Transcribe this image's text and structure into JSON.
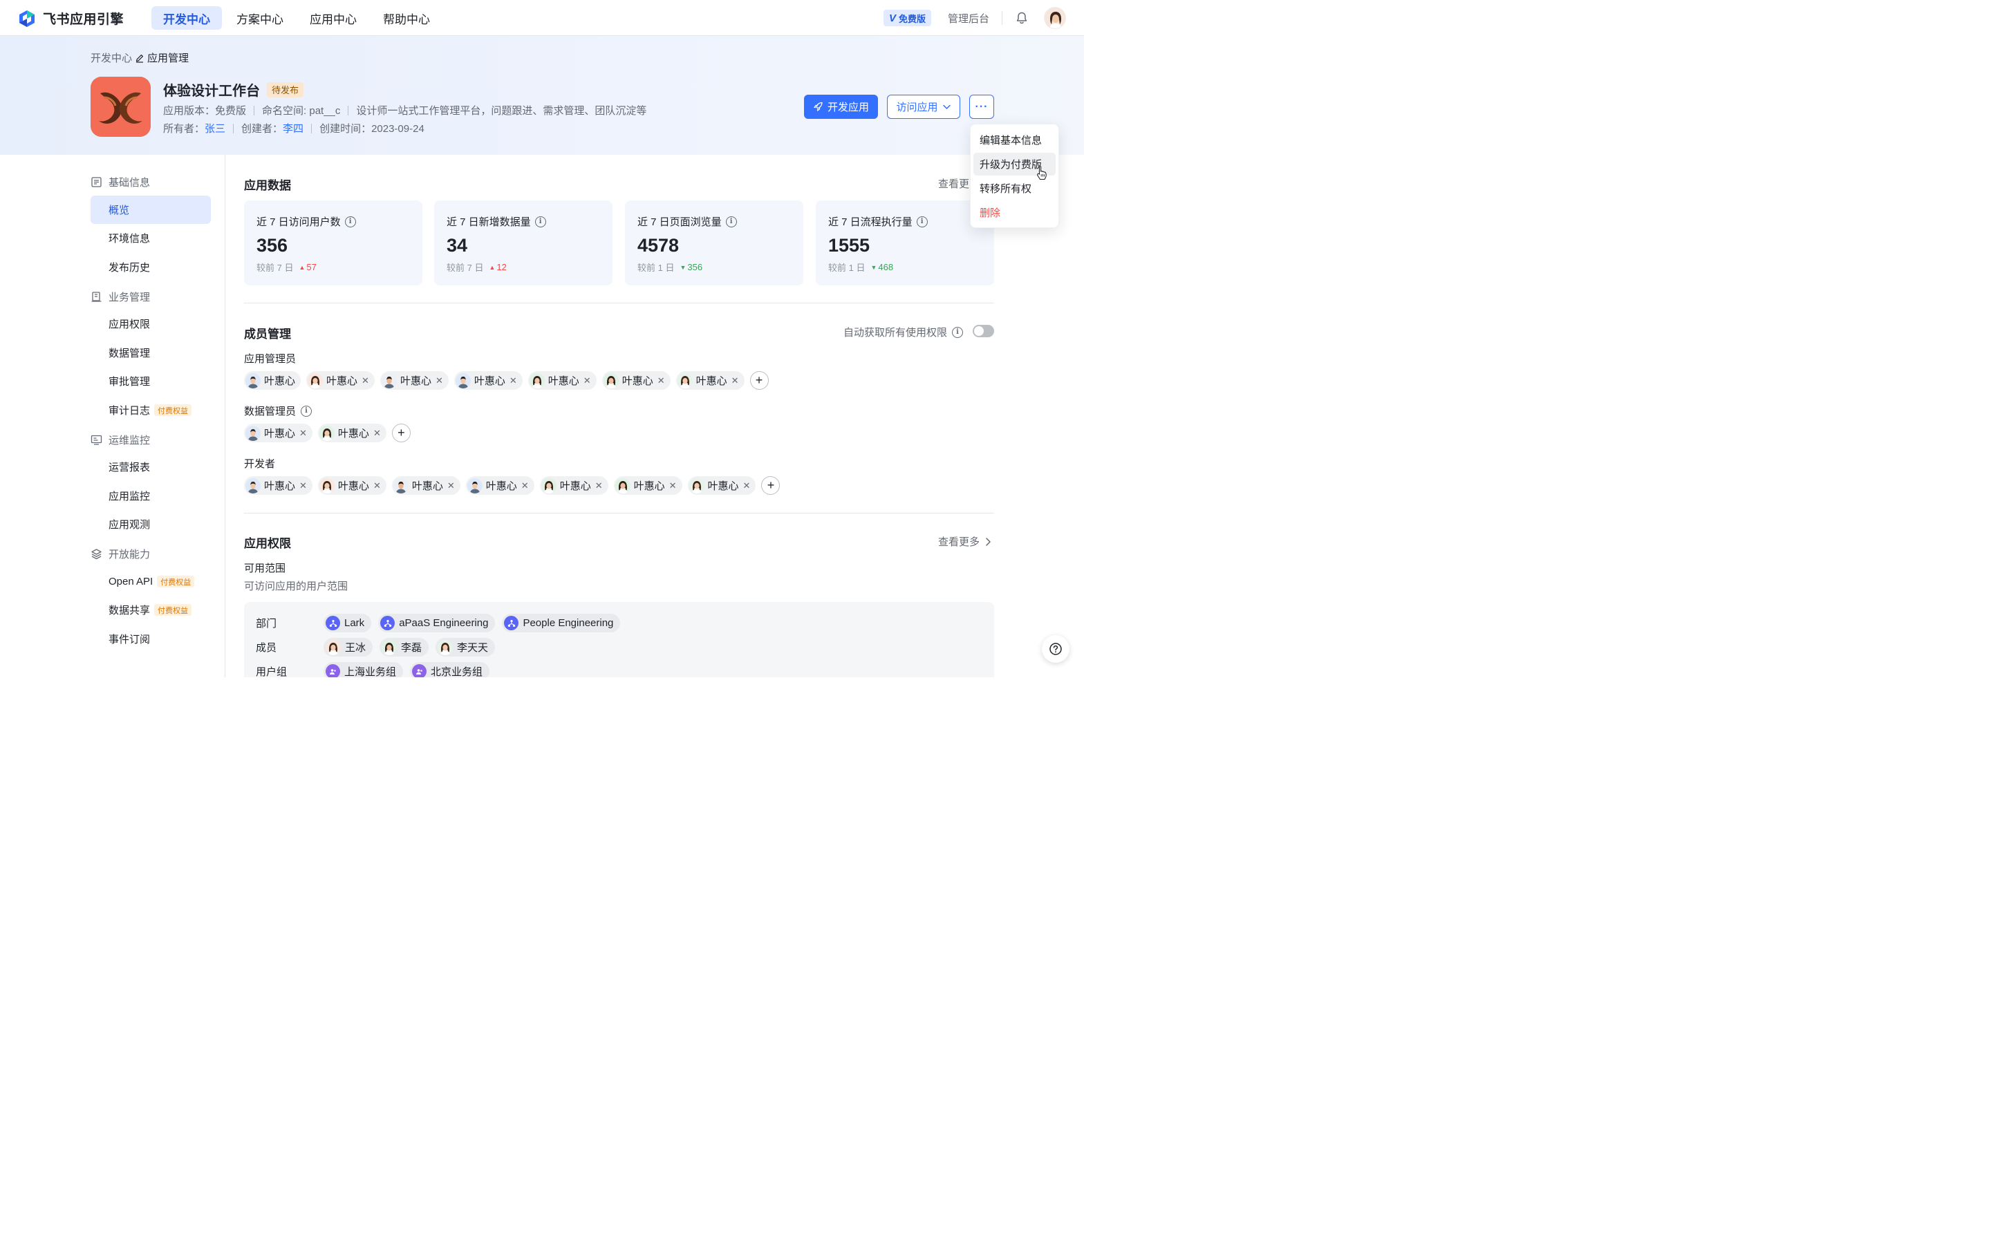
{
  "brand": {
    "name": "飞书应用引擎"
  },
  "nav": {
    "tabs": [
      "开发中心",
      "方案中心",
      "应用中心",
      "帮助中心"
    ],
    "plan_badge": "免费版",
    "plan_v": "V",
    "admin": "管理后台"
  },
  "breadcrumb": {
    "root": "开发中心",
    "current": "应用管理"
  },
  "app": {
    "name": "体验设计工作台",
    "status": "待发布",
    "version": "应用版本：免费版",
    "namespace": "命名空间: pat__c",
    "description": "设计师一站式工作管理平台，问题跟进、需求管理、团队沉淀等",
    "owner_label": "所有者：",
    "owner": "张三",
    "creator_label": "创建者：",
    "creator": "李四",
    "created": "创建时间：2023-09-24"
  },
  "actions": {
    "develop": "开发应用",
    "visit": "访问应用",
    "more": "···"
  },
  "dropdown": {
    "items": [
      "编辑基本信息",
      "升级为付费版",
      "转移所有权",
      "删除"
    ]
  },
  "sidebar": {
    "groups": [
      "基础信息",
      "业务管理",
      "运维监控",
      "开放能力"
    ],
    "items": [
      "概览",
      "环境信息",
      "发布历史",
      "应用权限",
      "数据管理",
      "审批管理",
      "审计日志",
      "运营报表",
      "应用监控",
      "应用观测",
      "Open API",
      "数据共享",
      "事件订阅"
    ],
    "paid_tag": "付费权益"
  },
  "app_data": {
    "title": "应用数据",
    "see_more": "查看更多",
    "cards": [
      {
        "label": "近 7 日访问用户数",
        "value": "356",
        "compare": "较前 7 日",
        "delta": "57",
        "dir": "up"
      },
      {
        "label": "近 7 日新增数据量",
        "value": "34",
        "compare": "较前 7 日",
        "delta": "12",
        "dir": "up"
      },
      {
        "label": "近 7 日页面浏览量",
        "value": "4578",
        "compare": "较前 1 日",
        "delta": "356",
        "dir": "down"
      },
      {
        "label": "近 7 日流程执行量",
        "value": "1555",
        "compare": "较前 1 日",
        "delta": "468",
        "dir": "down"
      }
    ]
  },
  "members": {
    "title": "成员管理",
    "auto_perm": "自动获取所有使用权限",
    "admins_label": "应用管理员",
    "data_admins_label": "数据管理员",
    "developers_label": "开发者",
    "member_name": "叶惠心"
  },
  "permissions": {
    "title": "应用权限",
    "see_more": "查看更多",
    "scope_title": "可用范围",
    "scope_desc": "可访问应用的用户范围",
    "dept_label": "部门",
    "depts": [
      "Lark",
      "aPaaS Engineering",
      "People Engineering"
    ],
    "member_label": "成员",
    "members": [
      "王冰",
      "李磊",
      "李天天"
    ],
    "group_label": "用户组",
    "groups": [
      "上海业务组",
      "北京业务组"
    ]
  }
}
